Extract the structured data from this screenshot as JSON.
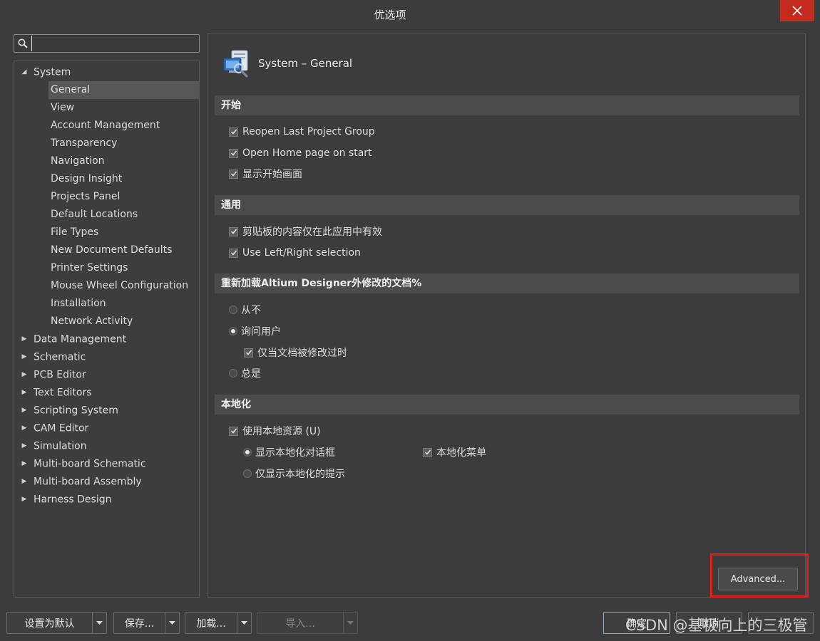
{
  "window": {
    "title": "优选项"
  },
  "search": {
    "placeholder": ""
  },
  "tree": {
    "items": [
      {
        "label": "System",
        "level": 0,
        "expanded": true
      },
      {
        "label": "General",
        "level": 1,
        "selected": true
      },
      {
        "label": "View",
        "level": 1
      },
      {
        "label": "Account Management",
        "level": 1
      },
      {
        "label": "Transparency",
        "level": 1
      },
      {
        "label": "Navigation",
        "level": 1
      },
      {
        "label": "Design Insight",
        "level": 1
      },
      {
        "label": "Projects Panel",
        "level": 1
      },
      {
        "label": "Default Locations",
        "level": 1
      },
      {
        "label": "File Types",
        "level": 1
      },
      {
        "label": "New Document Defaults",
        "level": 1
      },
      {
        "label": "Printer Settings",
        "level": 1
      },
      {
        "label": "Mouse Wheel Configuration",
        "level": 1
      },
      {
        "label": "Installation",
        "level": 1
      },
      {
        "label": "Network Activity",
        "level": 1
      },
      {
        "label": "Data Management",
        "level": 0
      },
      {
        "label": "Schematic",
        "level": 0
      },
      {
        "label": "PCB Editor",
        "level": 0
      },
      {
        "label": "Text Editors",
        "level": 0
      },
      {
        "label": "Scripting System",
        "level": 0
      },
      {
        "label": "CAM Editor",
        "level": 0
      },
      {
        "label": "Simulation",
        "level": 0
      },
      {
        "label": "Multi-board Schematic",
        "level": 0
      },
      {
        "label": "Multi-board Assembly",
        "level": 0
      },
      {
        "label": "Harness Design",
        "level": 0
      }
    ]
  },
  "panel": {
    "title": "System – General",
    "sections": {
      "start": {
        "header": "开始",
        "reopen": "Reopen Last Project Group",
        "home": "Open Home page on start",
        "splash": "显示开始画面"
      },
      "general": {
        "header": "通用",
        "clipboard": "剪贴板的内容仅在此应用中有效",
        "leftright": "Use Left/Right selection"
      },
      "reload": {
        "header": "重新加载Altium Designer外修改的文档%",
        "never": "从不",
        "ask": "询问用户",
        "only_modified": "仅当文档被修改过时",
        "always": "总是"
      },
      "localization": {
        "header": "本地化",
        "use_local": "使用本地资源 (U)",
        "show_dialogs": "显示本地化对话框",
        "local_menu": "本地化菜单",
        "hints_only": "仅显示本地化的提示"
      }
    },
    "advanced_label": "Advanced..."
  },
  "footer": {
    "set_default": "设置为默认",
    "save": "保存...",
    "load": "加载...",
    "import": "导入...",
    "ok": "确定",
    "cancel": "取消",
    "watermark": "CSDN @基极向上的三极管"
  },
  "colors": {
    "close": "#c42b1c",
    "highlight": "#e01f1f"
  }
}
